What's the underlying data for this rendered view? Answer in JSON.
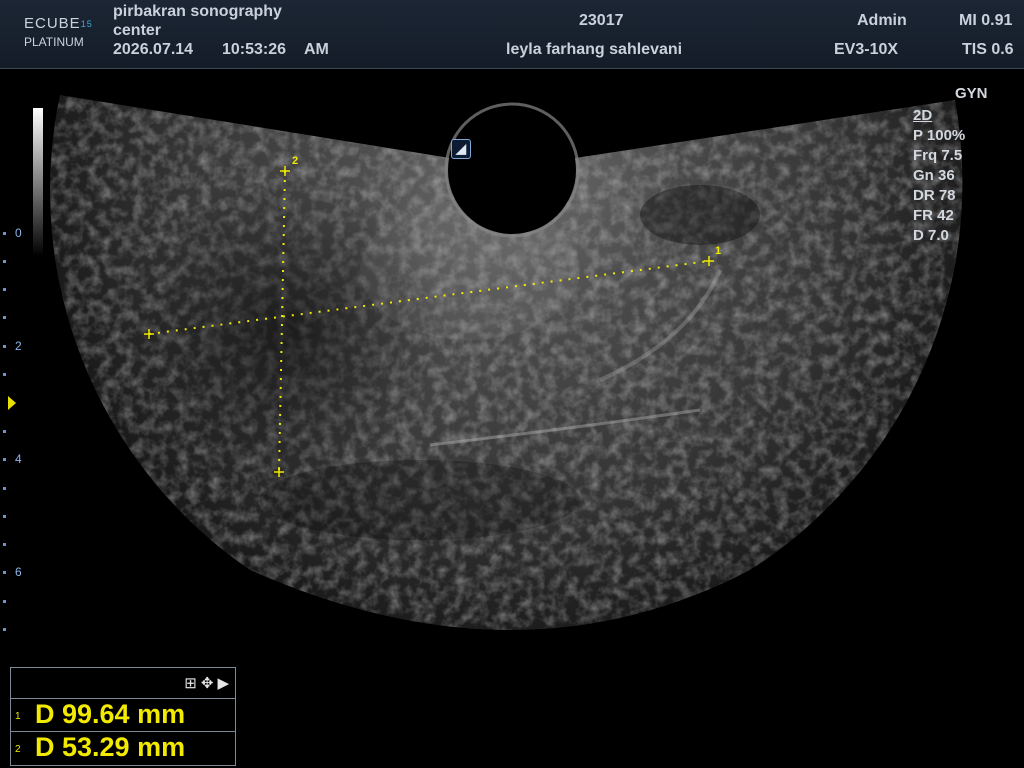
{
  "header": {
    "logo_line1": "ECUBE",
    "logo_num": "15",
    "logo_line2": "PLATINUM",
    "institution_line1": "pirbakran sonography",
    "institution_line2": "center",
    "date": "2026.07.14",
    "time": "10:53:26",
    "ampm": "AM",
    "patient_id": "23017",
    "patient_name": "leyla farhang sahlevani",
    "operator": "Admin",
    "probe": "EV3-10X",
    "mi": "MI 0.91",
    "tis": "TIS 0.6"
  },
  "preset": "GYN",
  "params": {
    "mode": "2D",
    "power": "P 100%",
    "freq": "Frq 7.5",
    "gain": "Gn 36",
    "dr": "DR 78",
    "fr": "FR 42",
    "depth": "D 7.0"
  },
  "depth_scale": [
    "0",
    "2",
    "4",
    "6"
  ],
  "measurements": [
    {
      "index": "1",
      "label": "D  99.64 mm"
    },
    {
      "index": "2",
      "label": "D  53.29 mm"
    }
  ],
  "calipers": {
    "cal1_label": "1",
    "cal2_label": "2"
  },
  "colors": {
    "caliper": "#f2ea00",
    "header_bg": "#18212d",
    "accent": "#3fa9d6"
  }
}
